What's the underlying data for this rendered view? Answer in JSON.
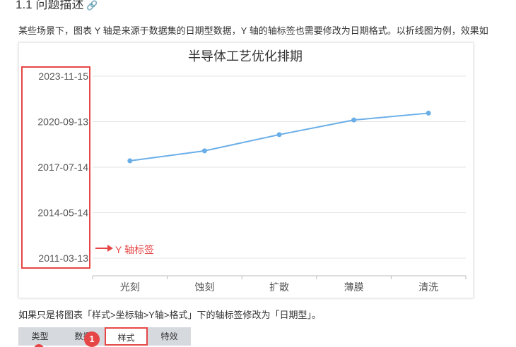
{
  "heading": {
    "text": "1.1 问题描述",
    "anchor": "🔗"
  },
  "intro": "某些场景下，图表 Y 轴是来源于数据集的日期型数据，Y 轴的轴标签也需要修改为日期格式。以折线图为例，效果如",
  "chart_data": {
    "type": "line",
    "title": "半导体工艺优化排期",
    "categories": [
      "光刻",
      "蚀刻",
      "扩散",
      "薄膜",
      "清洗"
    ],
    "series": [
      {
        "values": [
          "2017-12-22",
          "2018-09-02",
          "2019-10-19",
          "2020-10-26",
          "2021-04-18"
        ]
      }
    ],
    "y_ticks": [
      "2011-03-13",
      "2014-05-14",
      "2017-07-14",
      "2020-09-13",
      "2023-11-15"
    ],
    "ylim": [
      "2011-03-13",
      "2023-11-15"
    ],
    "grid": true,
    "legend": "none",
    "line_color": "#6aaee8"
  },
  "annotation": {
    "label": "Y 轴标签",
    "color": "#e64646"
  },
  "bottom_text": "如果只是将图表「样式>坐标轴>Y轴>格式」下的轴标签修改为「日期型」。",
  "tabs": [
    {
      "label": "类型"
    },
    {
      "label": "数据"
    },
    {
      "label": "样式"
    },
    {
      "label": "特效"
    }
  ],
  "badge": "1"
}
